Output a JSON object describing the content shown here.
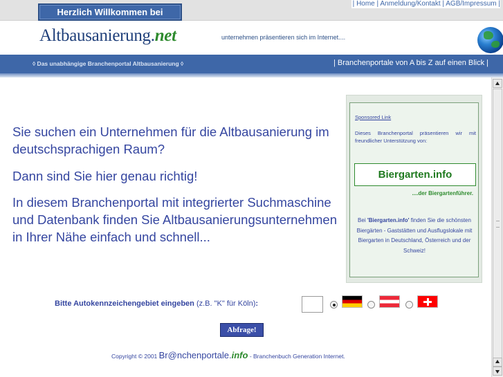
{
  "topbar": {
    "welcome": "Herzlich Willkommen bei",
    "links": [
      "Home",
      "Anmeldung/Kontakt",
      "AGB/Impressum"
    ]
  },
  "header": {
    "logo_main": "Altbausanierung.",
    "logo_suffix": "net",
    "slogan": "unternehmen präsentieren sich im Internet...."
  },
  "nav": {
    "left": "◊ Das unabhängige Branchenportal Altbausanierung ◊",
    "right": "| Branchenportale von A bis Z auf einen Blick |"
  },
  "main": {
    "intro1": "Sie suchen ein Unternehmen für die Altbausanierung im deutschsprachigen Raum?",
    "intro2": "Dann sind Sie hier genau richtig!",
    "intro3": "In diesem Branchenportal mit integrierter Suchmaschine und Datenbank finden Sie Altbausanierungsunternehmen in Ihrer Nähe einfach und schnell..."
  },
  "sponsor": {
    "link_label": "Sponsored Link",
    "desc": "Dieses Branchenportal präsentieren wir mit freundlicher Unterstützung von:",
    "button": "Biergarten.info",
    "sub": "....der Biergartenführer.",
    "body_prefix": "Bei ",
    "body_brand": "'Biergarten.info'",
    "body_rest": " finden Sie die schönsten Biergärten - Gaststätten und Ausflugslokale mit Biergarten in Deutschland, Österreich und der Schweiz!"
  },
  "form": {
    "label": "Bitte Autokennzeichengebiet eingeben",
    "example": " (z.B. \"K\" für Köln)",
    "colon": ":",
    "input_value": "",
    "selected_country": "Deutschland",
    "submit": "Abfrage!"
  },
  "footer": {
    "copy_prefix": "Copyright © 2001 ",
    "brand": "Br@nchenportale.",
    "brand_suffix": "info",
    "copy_suffix": " - Branchenbuch Generation Internet."
  },
  "colors": {
    "brand_blue": "#3e67a8",
    "text_blue": "#3546a0",
    "accent_green": "#2e8b2e"
  }
}
